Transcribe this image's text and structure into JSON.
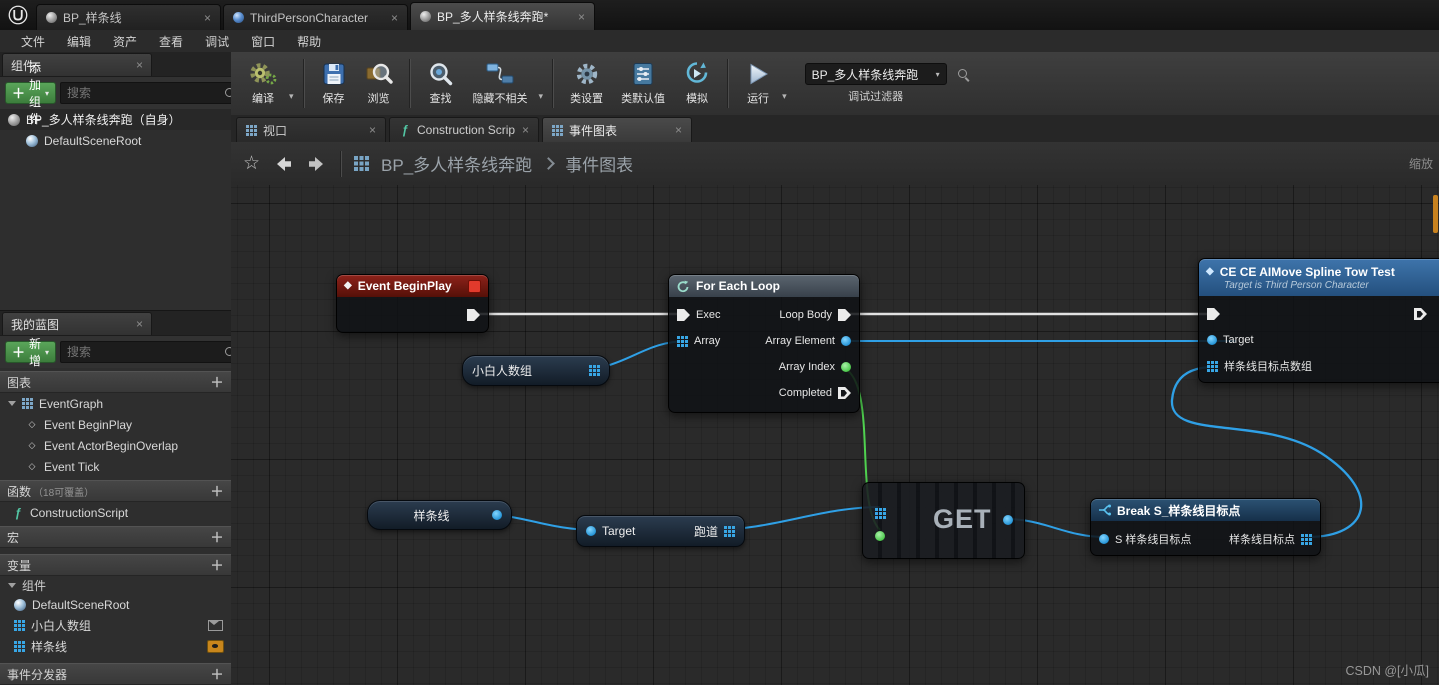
{
  "colors": {
    "exec_wire": "#e2e2e2",
    "data_wire": "#2fa0e6",
    "int_wire": "#4fd14f",
    "event_header": "#8e221a",
    "function_header": "#3e74ab",
    "accent_green": "#4f9e4f"
  },
  "titlebar": {
    "tabs": [
      {
        "label": "BP_样条线"
      },
      {
        "label": "ThirdPersonCharacter"
      },
      {
        "label": "BP_多人样条线奔跑*"
      }
    ]
  },
  "menubar": {
    "items": [
      "文件",
      "编辑",
      "资产",
      "查看",
      "调试",
      "窗口",
      "帮助"
    ]
  },
  "components_panel": {
    "tab_label": "组件",
    "add_button": "添加组件",
    "search_placeholder": "搜索",
    "root_item": "BP_多人样条线奔跑（自身）",
    "child_item": "DefaultSceneRoot"
  },
  "toolbar": {
    "compile": "编译",
    "save": "保存",
    "browse": "浏览",
    "find": "查找",
    "hide_unrelated": "隐藏不相关",
    "class_settings": "类设置",
    "class_defaults": "类默认值",
    "simulate": "模拟",
    "play": "运行",
    "debug_object": "BP_多人样条线奔跑",
    "debug_filter_label": "调试过滤器"
  },
  "doc_tabs": {
    "viewport": "视口",
    "construction": "Construction Scrip",
    "event_graph": "事件图表"
  },
  "breadcrumb": {
    "blueprint": "BP_多人样条线奔跑",
    "graph": "事件图表",
    "zoom_label": "缩放"
  },
  "my_blueprint": {
    "tab_label": "我的蓝图",
    "add_button": "新增",
    "search_placeholder": "搜索",
    "graphs_section": "图表",
    "event_graph": "EventGraph",
    "events": [
      "Event BeginPlay",
      "Event ActorBeginOverlap",
      "Event Tick"
    ],
    "functions_section": "函数",
    "functions_note": "（18可覆盖）",
    "construction_script": "ConstructionScript",
    "macros_section": "宏",
    "variables_section": "变量",
    "components_category": "组件",
    "variables": [
      "DefaultSceneRoot",
      "小白人数组",
      "样条线"
    ],
    "dispatchers_section": "事件分发器"
  },
  "graph": {
    "nodes": {
      "begin_play": {
        "title": "Event BeginPlay"
      },
      "for_each_loop": {
        "title": "For Each Loop",
        "exec_in": "Exec",
        "array_in": "Array",
        "loop_body": "Loop Body",
        "array_element": "Array Element",
        "array_index": "Array Index",
        "completed": "Completed"
      },
      "array_var": {
        "label": "小白人数组"
      },
      "ai_move": {
        "title": "CE CE AIMove Spline Tow Test",
        "subtitle": "Target is Third Person Character",
        "target_in": "Target",
        "spline_points_in": "样条线目标点数组"
      },
      "spline_var": {
        "label": "样条线"
      },
      "track_getter": {
        "target_pin": "Target",
        "label": "跑道"
      },
      "array_get": {
        "title": "GET"
      },
      "break_struct": {
        "title": "Break S_样条线目标点",
        "input": "S 样条线目标点",
        "output": "样条线目标点"
      }
    }
  },
  "watermark": "CSDN @[小瓜]"
}
